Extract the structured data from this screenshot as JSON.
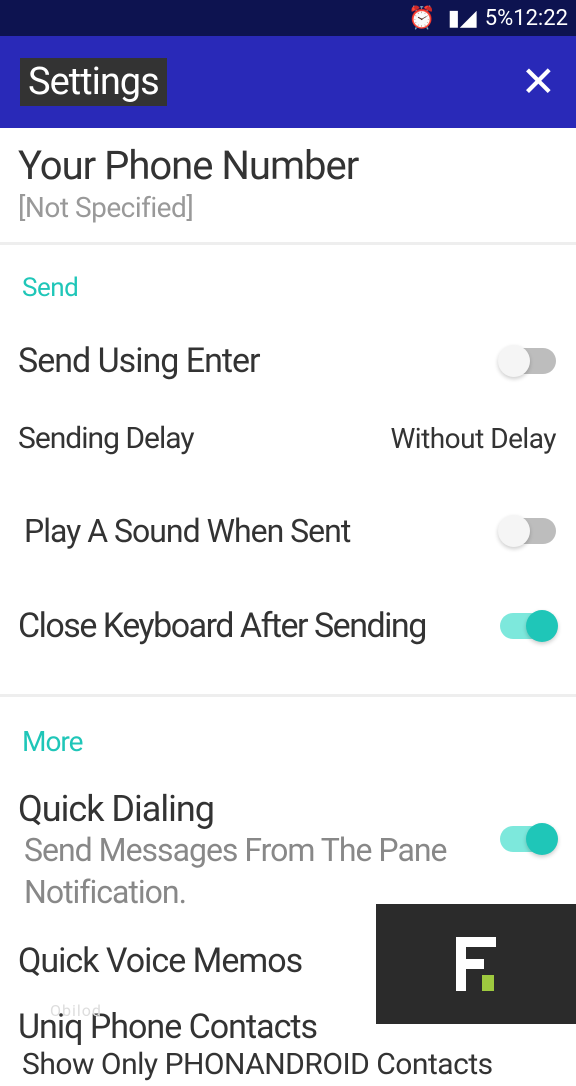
{
  "statusBar": {
    "battery": "5%",
    "time": "12:22"
  },
  "header": {
    "title": "Settings"
  },
  "phone": {
    "title": "Your Phone Number",
    "subtitle": "[Not Specified]"
  },
  "sections": {
    "send": {
      "header": "Send",
      "sendEnter": "Send Using Enter",
      "sendingDelay": "Sending Delay",
      "sendingDelayValue": "Without Delay",
      "playSound": "Play A Sound When Sent",
      "closeKeyboard": "Close Keyboard After Sending"
    },
    "more": {
      "header": "More",
      "quickDialTitle": "Quick Dialing",
      "quickDialSub1": "Send Messages From The Pane",
      "quickDialSub2": "Notification.",
      "voiceMemos": "Quick Voice Memos",
      "contactsTitle": "Uniq Phone Contacts",
      "contactsSub": "Show Only PHONANDROID Contacts"
    }
  },
  "watermark": "Obilod"
}
